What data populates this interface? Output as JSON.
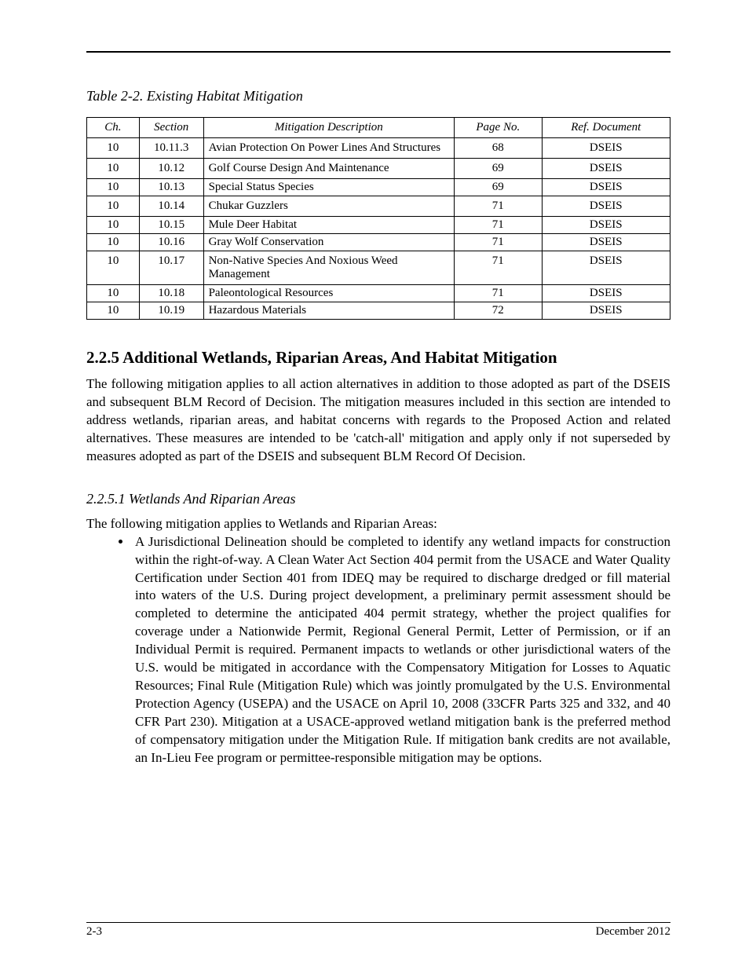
{
  "table": {
    "caption": "Table 2-2. Existing Habitat Mitigation",
    "headers": [
      "Ch.",
      "Section",
      "Mitigation Description",
      "Page No.",
      "Ref. Document"
    ],
    "rows": [
      {
        "ch": "10",
        "section": "10.11.3",
        "desc": "Avian Protection On Power Lines And Structures",
        "page": "68",
        "ref": "DSEIS"
      },
      {
        "ch": "10",
        "section": "10.12",
        "desc": "Golf Course Design And Maintenance",
        "page": "69",
        "ref": "DSEIS"
      },
      {
        "ch": "10",
        "section": "10.13",
        "desc": "Special Status Species",
        "page": "69",
        "ref": "DSEIS"
      },
      {
        "ch": "10",
        "section": "10.14",
        "desc": "Chukar Guzzlers",
        "page": "71",
        "ref": "DSEIS"
      },
      {
        "ch": "10",
        "section": "10.15",
        "desc": "Mule Deer Habitat",
        "page": "71",
        "ref": "DSEIS"
      },
      {
        "ch": "10",
        "section": "10.16",
        "desc": "Gray Wolf Conservation",
        "page": "71",
        "ref": "DSEIS"
      },
      {
        "ch": "10",
        "section": "10.17",
        "desc": "Non-Native Species And Noxious Weed Management",
        "page": "71",
        "ref": "DSEIS"
      },
      {
        "ch": "10",
        "section": "10.18",
        "desc": "Paleontological Resources",
        "page": "71",
        "ref": "DSEIS"
      },
      {
        "ch": "10",
        "section": "10.19",
        "desc": "Hazardous Materials",
        "page": "72",
        "ref": "DSEIS"
      }
    ]
  },
  "sections": {
    "mitigation_heading": "2.2.5 Additional Wetlands, Riparian Areas, And Habitat Mitigation",
    "mitigation_intro": "The following mitigation applies to all action alternatives in addition to those adopted as part of the DSEIS and subsequent BLM Record of Decision. The mitigation measures included in this section are intended to address wetlands, riparian areas, and habitat concerns with regards to the Proposed Action and related alternatives. These measures are intended to be 'catch-all' mitigation and apply only if not superseded by measures adopted as part of the DSEIS and subsequent BLM Record Of Decision.",
    "wra_heading": "2.2.5.1 Wetlands And Riparian Areas",
    "wra_body": "The following mitigation applies to Wetlands and Riparian Areas:",
    "wra_bullet": "A Jurisdictional Delineation should be completed to identify any wetland impacts for construction within the right-of-way. A Clean Water Act Section 404 permit from the USACE and Water Quality Certification under Section 401 from IDEQ may be required to discharge dredged or fill material into waters of the U.S. During project development, a preliminary permit assessment should be completed to determine the anticipated 404 permit strategy, whether the project qualifies for coverage under a Nationwide Permit, Regional General Permit, Letter of Permission, or if an Individual Permit is required. Permanent impacts to wetlands or other jurisdictional waters of the U.S. would be mitigated in accordance with the Compensatory Mitigation for Losses to Aquatic Resources; Final Rule (Mitigation Rule) which was jointly promulgated by the U.S. Environmental Protection Agency (USEPA) and the USACE on April 10, 2008 (33CFR Parts 325 and 332, and 40 CFR Part 230). Mitigation at a USACE-approved wetland mitigation bank is the preferred method of compensatory mitigation under the Mitigation Rule. If mitigation bank credits are not available, an In-Lieu Fee program or permittee-responsible mitigation may be options."
  },
  "footer": {
    "left": "2-3",
    "right": "December 2012"
  }
}
